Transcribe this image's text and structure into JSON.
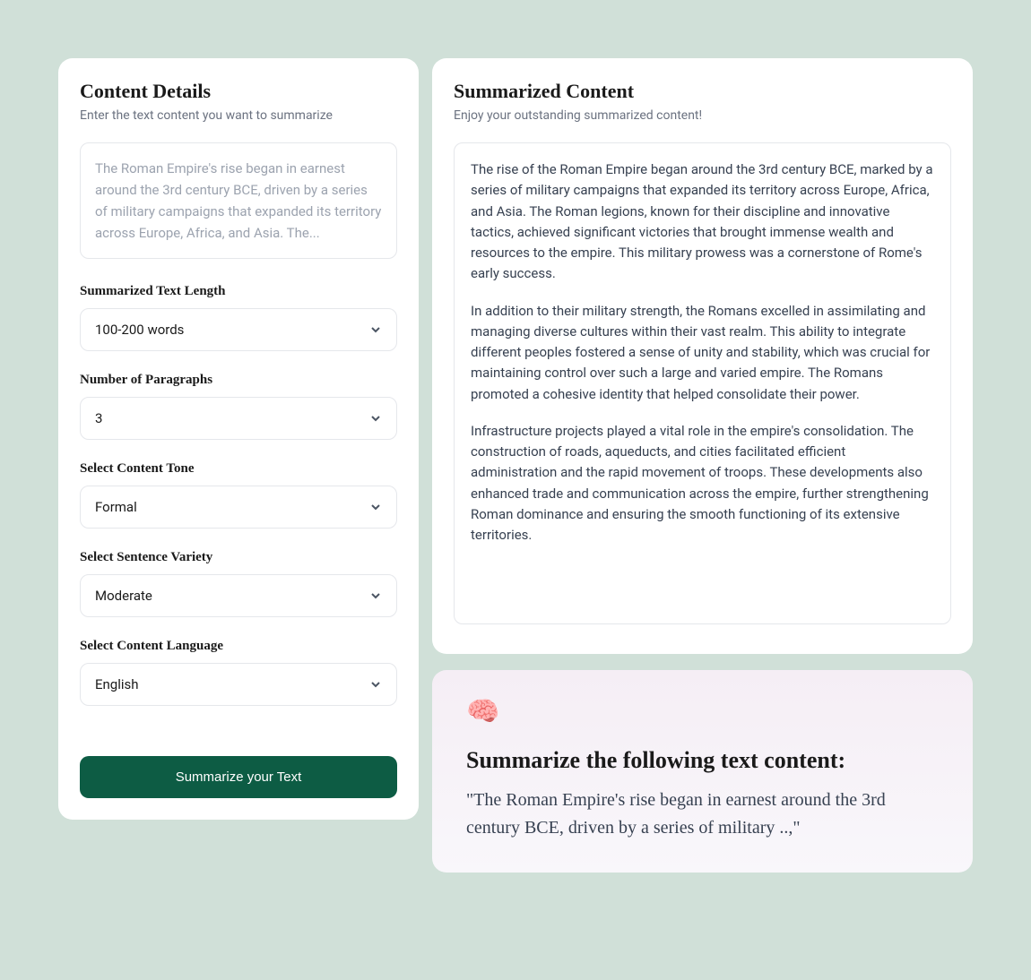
{
  "details": {
    "title": "Content Details",
    "subtitle": "Enter the text content you want to summarize",
    "input_text": "The Roman Empire's rise began in earnest around the 3rd century BCE, driven by a series of military campaigns that expanded its territory across Europe, Africa, and Asia. The...",
    "fields": {
      "length": {
        "label": "Summarized Text Length",
        "value": "100-200 words"
      },
      "paragraphs": {
        "label": "Number of Paragraphs",
        "value": "3"
      },
      "tone": {
        "label": "Select Content Tone",
        "value": "Formal"
      },
      "variety": {
        "label": "Select Sentence Variety",
        "value": "Moderate"
      },
      "language": {
        "label": "Select Content Language",
        "value": "English"
      }
    },
    "button": "Summarize your Text"
  },
  "summary": {
    "title": "Summarized Content",
    "subtitle": "Enjoy your outstanding summarized content!",
    "paragraphs": [
      "The rise of the Roman Empire began around the 3rd century BCE, marked by a series of military campaigns that expanded its territory across Europe, Africa, and Asia. The Roman legions, known for their discipline and innovative tactics, achieved significant victories that brought immense wealth and resources to the empire. This military prowess was a cornerstone of Rome's early success.",
      "In addition to their military strength, the Romans excelled in assimilating and managing diverse cultures within their vast realm. This ability to integrate different peoples fostered a sense of unity and stability, which was crucial for maintaining control over such a large and varied empire. The Romans promoted a cohesive identity that helped consolidate their power.",
      "Infrastructure projects played a vital role in the empire's consolidation. The construction of roads, aqueducts, and cities facilitated efficient administration and the rapid movement of troops. These developments also enhanced trade and communication across the empire, further strengthening Roman dominance and ensuring the smooth functioning of its extensive territories."
    ]
  },
  "prompt": {
    "icon": "brain-icon",
    "title": "Summarize the following text content:",
    "text": "\"The Roman Empire's rise began in earnest around the 3rd century BCE, driven by a series of military ..,\""
  }
}
